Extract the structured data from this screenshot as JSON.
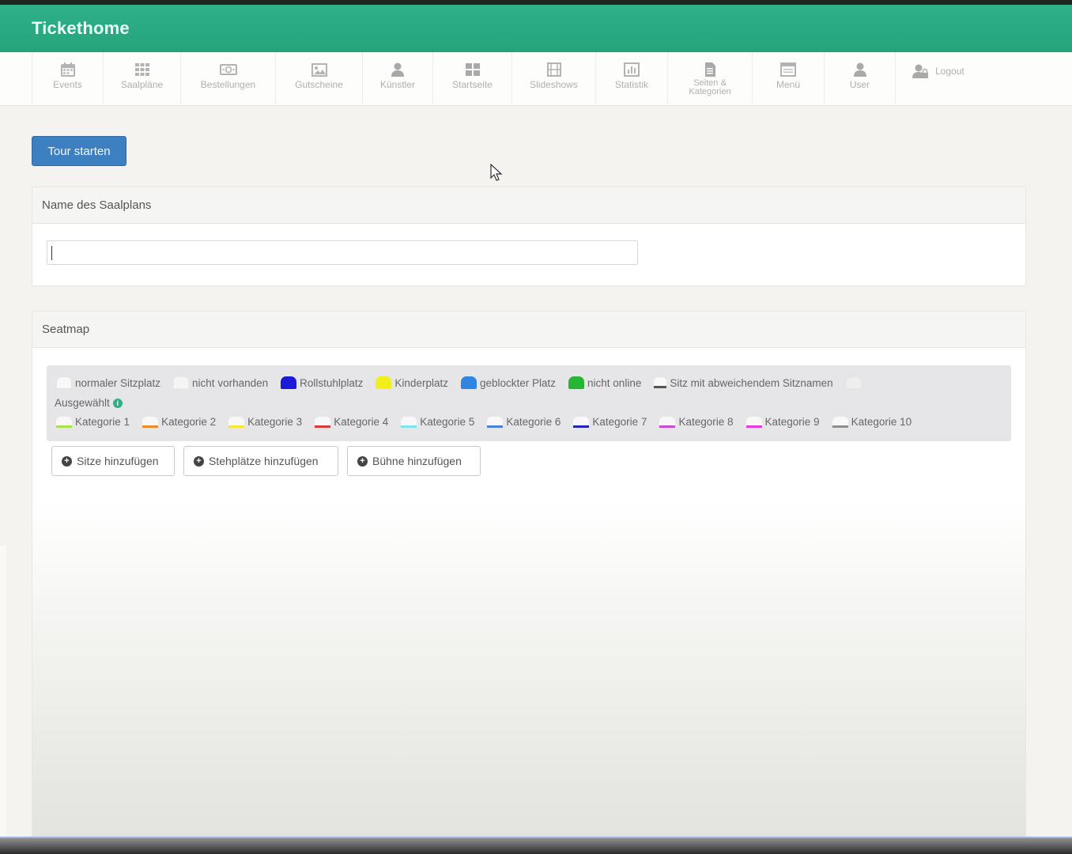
{
  "app": {
    "brand": "Tickethome",
    "brand_color": "#2fb088"
  },
  "nav": [
    {
      "label": "Events",
      "icon": "calendar-icon"
    },
    {
      "label": "Saalpläne",
      "icon": "grid-icon"
    },
    {
      "label": "Bestellungen",
      "icon": "money-icon"
    },
    {
      "label": "Gutscheine",
      "icon": "picture-icon"
    },
    {
      "label": "Künstler",
      "icon": "user-icon"
    },
    {
      "label": "Startseite",
      "icon": "dashboard-icon"
    },
    {
      "label": "Slideshows",
      "icon": "film-icon"
    },
    {
      "label": "Statistik",
      "icon": "chart-icon"
    },
    {
      "label_line1": "Seiten &",
      "label_line2": "Kategorien",
      "icon": "file-icon"
    },
    {
      "label": "Menü",
      "icon": "menu-window-icon"
    },
    {
      "label": "User",
      "icon": "user-icon"
    }
  ],
  "logout": {
    "label": "Logout",
    "icon": "user-lock-icon"
  },
  "tour": {
    "label": "Tour starten",
    "color": "#3d80c1"
  },
  "name_panel": {
    "title": "Name des Saalplans",
    "value": ""
  },
  "seatmap": {
    "title": "Seatmap",
    "legend": [
      {
        "label": "normaler Sitzplatz",
        "color": "#f8f8f8"
      },
      {
        "label": "nicht vorhanden",
        "color": "#f5f5f5"
      },
      {
        "label": "Rollstuhlplatz",
        "color": "#1b1bd6"
      },
      {
        "label": "Kinderplatz",
        "color": "#f2ee1a"
      },
      {
        "label": "geblockter Platz",
        "color": "#2f86e0"
      },
      {
        "label": "nicht online",
        "color": "#27b536"
      },
      {
        "label": "Sitz mit abweichendem Sitznamen",
        "color": "#f8f8f8"
      },
      {
        "label": "Ausgewählt",
        "color": "#eeeeee"
      }
    ],
    "categories": [
      {
        "label": "Kategorie 1",
        "color": "#a6e34a"
      },
      {
        "label": "Kategorie 2",
        "color": "#ee8a2c"
      },
      {
        "label": "Kategorie 3",
        "color": "#f2e63a"
      },
      {
        "label": "Kategorie 4",
        "color": "#dd3a3a"
      },
      {
        "label": "Kategorie 5",
        "color": "#7fe3ee"
      },
      {
        "label": "Kategorie 6",
        "color": "#4a7fe0"
      },
      {
        "label": "Kategorie 7",
        "color": "#2424b8"
      },
      {
        "label": "Kategorie 8",
        "color": "#c84ad6"
      },
      {
        "label": "Kategorie 9",
        "color": "#e63adf"
      },
      {
        "label": "Kategorie 10",
        "color": "#8e8e8e"
      }
    ],
    "buttons": [
      {
        "label": "Sitze hinzufügen"
      },
      {
        "label": "Stehplätze hinzufügen"
      },
      {
        "label": "Bühne hinzufügen"
      }
    ]
  }
}
